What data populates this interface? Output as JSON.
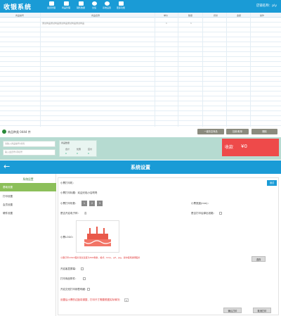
{
  "app": {
    "title": "收银系统",
    "shop_name": "店铺名称：ply",
    "toolbar": [
      {
        "label": "会员管理",
        "icon": "member-icon"
      },
      {
        "label": "商品管理",
        "icon": "goods-icon"
      },
      {
        "label": "销售数据",
        "icon": "sales-icon"
      },
      {
        "label": "交班",
        "icon": "shift-icon"
      },
      {
        "label": "系统设置",
        "icon": "settings-icon"
      },
      {
        "label": "更多功能",
        "icon": "more-icon"
      }
    ],
    "grid": {
      "columns": [
        "商品编号",
        "商品名称",
        "单价",
        "数量",
        "折扣",
        "金额",
        "操作"
      ],
      "first_row": {
        "name": "测试商品测试商品测试商品测试商品测试商品",
        "price": "1",
        "qty": "1"
      }
    },
    "status": {
      "text": "商品种类  0444  件"
    },
    "action_buttons": [
      "一键清空商品",
      "挂单/取单",
      "删除"
    ],
    "inputs": [
      {
        "placeholder": "请输入商品编号/条码"
      },
      {
        "placeholder": "输入会员号/手机号"
      }
    ],
    "summary": {
      "label": "商品数量",
      "total_label": "合计",
      "discount_label": "优惠",
      "pay_label": "应付",
      "total": "0",
      "discount": "0",
      "pay": "0"
    },
    "checkout": {
      "label": "收款",
      "amount": "¥0"
    }
  },
  "settings": {
    "title": "系统设置",
    "sidebar_heading": "系统设置",
    "sidebar_items": [
      "基础设置",
      "打印设置",
      "会员设置",
      "硬件设置"
    ],
    "rows": {
      "printer_label": "小票打印机：",
      "printer_btn": "测试",
      "receipt_title": "小票打印标题：欢迎光临小店咚咚",
      "print_count_label": "小票打印份数：",
      "print_counts": [
        "1",
        "2",
        "3"
      ],
      "receipt_width_label": "小票宽度(mm)：",
      "scale_label": "是否开启电子秤：",
      "scale_value": "否",
      "drawer_label": "是否打印后弹出钱箱：",
      "logo_label": "小票LOGO：",
      "logo_hint": "小票打印LOGO图片建议宽度为300像素，格式：bmp，gif，jpg。请勿使用透明图片",
      "logo_btn": "选择",
      "customer_label": "开启客显屏幕：",
      "accessory_label": "打印商品附件：",
      "auto_print_label": "开启交班打印销售明细：",
      "warning": "设置后小票的边距将调整，打印尺寸需要根据实际情况：",
      "warning_select": "1",
      "save_btn": "确认打印",
      "cancel_btn": "取消打印"
    }
  },
  "colors": {
    "primary": "#1a9bd6",
    "accent_green": "#8cbf5a",
    "pay_red": "#ee4a4a",
    "panel_teal": "#b6dbd1"
  }
}
